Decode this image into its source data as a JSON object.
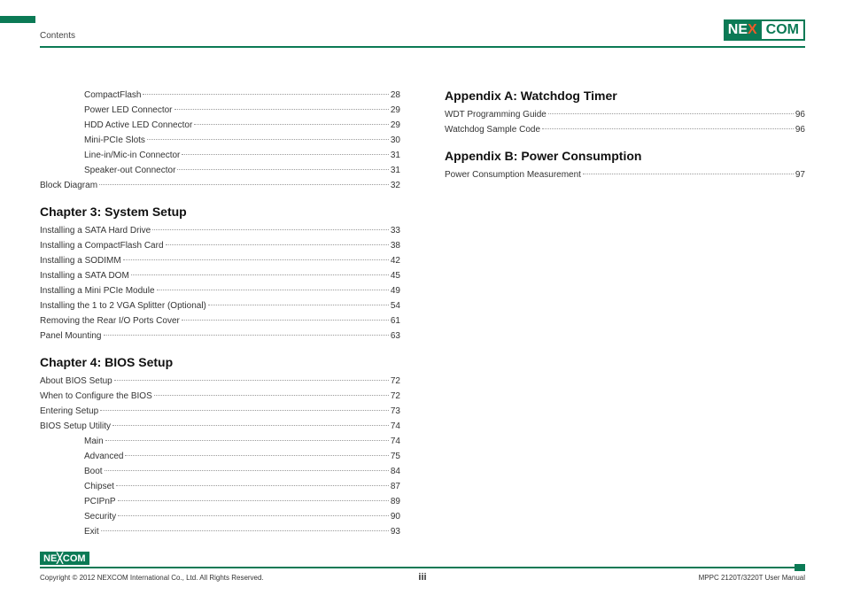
{
  "header": {
    "crumb": "Contents",
    "logo_left": "NE",
    "logo_x": "X",
    "logo_right": "COM"
  },
  "left": {
    "pre": [
      {
        "i": true,
        "label": "CompactFlash",
        "page": "28"
      },
      {
        "i": true,
        "label": "Power LED Connector",
        "page": "29"
      },
      {
        "i": true,
        "label": "HDD Active LED Connector",
        "page": "29"
      },
      {
        "i": true,
        "label": "Mini-PCIe Slots",
        "page": "30"
      },
      {
        "i": true,
        "label": "Line-in/Mic-in Connector",
        "page": "31"
      },
      {
        "i": true,
        "label": "Speaker-out Connector",
        "page": "31"
      },
      {
        "i": false,
        "label": "Block Diagram",
        "page": "32"
      }
    ],
    "ch3": {
      "title": "Chapter 3: System Setup",
      "rows": [
        {
          "label": "Installing a SATA Hard Drive",
          "page": "33"
        },
        {
          "label": "Installing a CompactFlash Card",
          "page": "38"
        },
        {
          "label": "Installing a SODIMM",
          "page": "42"
        },
        {
          "label": "Installing a SATA DOM",
          "page": "45"
        },
        {
          "label": "Installing a Mini PCIe Module",
          "page": "49"
        },
        {
          "label": "Installing the 1 to 2 VGA Splitter (Optional)",
          "page": "54"
        },
        {
          "label": "Removing the Rear I/O Ports Cover",
          "page": "61"
        },
        {
          "label": "Panel Mounting",
          "page": "63"
        }
      ]
    },
    "ch4": {
      "title": "Chapter 4: BIOS Setup",
      "rows": [
        {
          "i": false,
          "label": "About BIOS Setup",
          "page": "72"
        },
        {
          "i": false,
          "label": "When to Configure the BIOS",
          "page": "72"
        },
        {
          "i": false,
          "label": "Entering Setup",
          "page": "73"
        },
        {
          "i": false,
          "label": "BIOS Setup Utility",
          "page": "74"
        },
        {
          "i": true,
          "label": "Main",
          "page": "74"
        },
        {
          "i": true,
          "label": "Advanced",
          "page": "75"
        },
        {
          "i": true,
          "label": "Boot",
          "page": "84"
        },
        {
          "i": true,
          "label": "Chipset",
          "page": "87"
        },
        {
          "i": true,
          "label": "PCIPnP",
          "page": "89"
        },
        {
          "i": true,
          "label": "Security",
          "page": "90"
        },
        {
          "i": true,
          "label": "Exit",
          "page": "93"
        }
      ]
    }
  },
  "right": {
    "apA": {
      "title": "Appendix A: Watchdog Timer",
      "rows": [
        {
          "label": "WDT Programming Guide",
          "page": "96"
        },
        {
          "label": "Watchdog Sample Code",
          "page": "96"
        }
      ]
    },
    "apB": {
      "title": "Appendix B: Power Consumption",
      "rows": [
        {
          "label": "Power Consumption Measurement",
          "page": "97"
        }
      ]
    }
  },
  "footer": {
    "copyright": "Copyright © 2012 NEXCOM International Co., Ltd. All Rights Reserved.",
    "page": "iii",
    "manual": "MPPC 2120T/3220T User Manual",
    "logo": "NE COM"
  }
}
